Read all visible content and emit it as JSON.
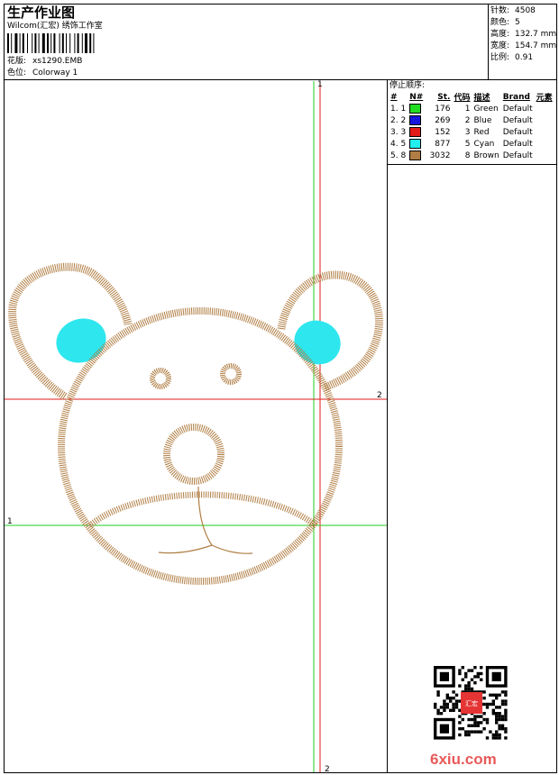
{
  "header": {
    "title": "生产作业图",
    "company": "Wilcom(汇宏) 绣饰工作室",
    "design_label": "花版:",
    "design_value": "xs1290.EMB",
    "colorway_label": "色位:",
    "colorway_value": "Colorway 1"
  },
  "stats": [
    {
      "label": "针数:",
      "value": "4508"
    },
    {
      "label": "颜色:",
      "value": "5"
    },
    {
      "label": "高度:",
      "value": "132.7 mm"
    },
    {
      "label": "宽度:",
      "value": "154.7 mm"
    },
    {
      "label": "比例:",
      "value": "0.91"
    }
  ],
  "stop_sequence": {
    "title": "停止顺序:",
    "columns": [
      "#",
      "N#",
      "St.",
      "代码",
      "描述",
      "Brand",
      "元素"
    ],
    "rows": [
      {
        "idx": "1. 1",
        "color": "#22dd22",
        "st": "176",
        "code": "1",
        "desc": "Green",
        "brand": "Default"
      },
      {
        "idx": "2. 2",
        "color": "#1515dd",
        "st": "269",
        "code": "2",
        "desc": "Blue",
        "brand": "Default"
      },
      {
        "idx": "3. 3",
        "color": "#e11a1a",
        "st": "152",
        "code": "3",
        "desc": "Red",
        "brand": "Default"
      },
      {
        "idx": "4. 5",
        "color": "#22eeee",
        "st": "877",
        "code": "5",
        "desc": "Cyan",
        "brand": "Default"
      },
      {
        "idx": "5. 8",
        "color": "#b07e44",
        "st": "3032",
        "code": "8",
        "desc": "Brown",
        "brand": "Default"
      }
    ]
  },
  "guides": {
    "red_v_top": "1",
    "red_v_bottom": "2",
    "red_h_right": "2",
    "green_h_left": "1"
  },
  "watermark": {
    "text": "6xiu.com",
    "seal_text": "汇宏"
  },
  "colors": {
    "thread_brown": "#b07e44",
    "thread_cyan": "#22eeee",
    "guide_red": "#e11a1a",
    "guide_green": "#22cc22"
  }
}
